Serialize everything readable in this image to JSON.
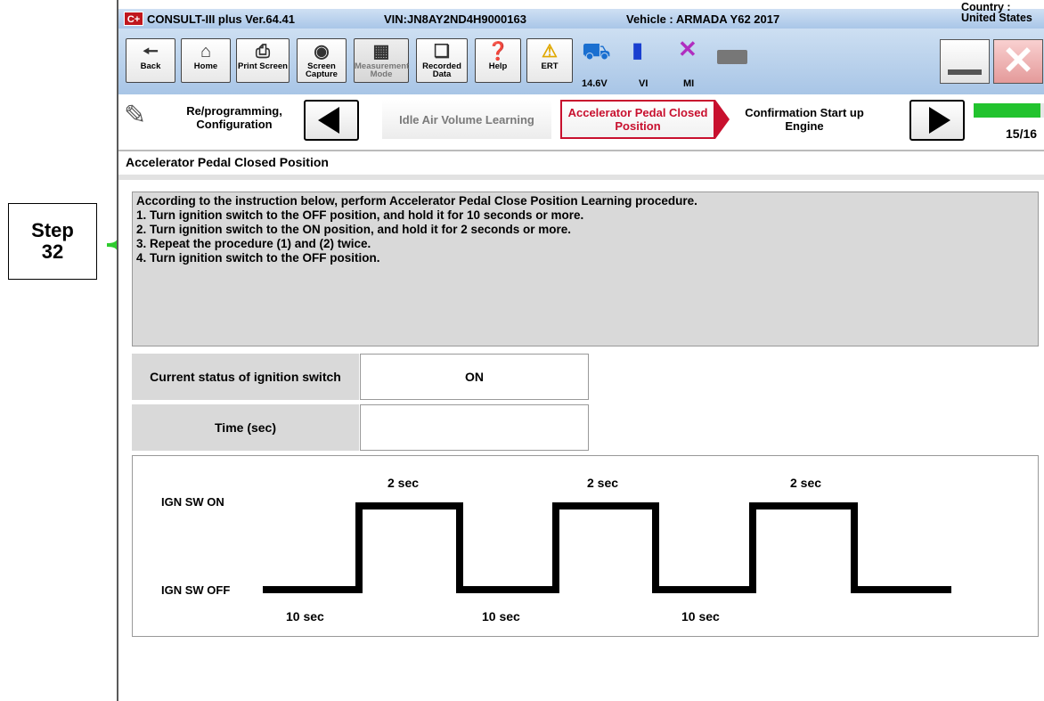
{
  "callout": {
    "line1": "Step",
    "line2": "32"
  },
  "titlebar": {
    "app_logo": "C+",
    "app_name": "CONSULT-III plus  Ver.64.41",
    "vin": "VIN:JN8AY2ND4H9000163",
    "vehicle": "Vehicle : ARMADA Y62 2017",
    "country": "Country : United States"
  },
  "toolbar": {
    "back": "Back",
    "home": "Home",
    "print": "Print Screen",
    "capture": "Screen Capture",
    "measurement": "Measurement Mode",
    "recorded": "Recorded Data",
    "help": "Help",
    "ert": "ERT",
    "voltage": "14.6V",
    "vi": "VI",
    "mi": "MI"
  },
  "nav": {
    "reprog": "Re/programming, Configuration",
    "idle": "Idle Air Volume Learning",
    "accel": "Accelerator Pedal Closed Position",
    "confirm": "Confirmation Start up Engine",
    "progress": "15/16",
    "progress_fraction": 0.9375
  },
  "page_title": "Accelerator Pedal Closed Position",
  "instructions": "According to the instruction below, perform Accelerator Pedal Close Position Learning procedure.\n1. Turn ignition switch to the OFF position, and hold it for 10 seconds or more.\n2. Turn ignition switch to the ON position, and hold it for 2 seconds or more.\n3. Repeat the procedure (1) and (2) twice.\n4. Turn ignition switch to the OFF position.",
  "status": {
    "ign_label": "Current status of ignition switch",
    "ign_value": "ON",
    "time_label": "Time (sec)",
    "time_value": ""
  },
  "diagram": {
    "on_label": "IGN SW ON",
    "off_label": "IGN SW OFF",
    "on_durations": [
      "2 sec",
      "2 sec",
      "2 sec"
    ],
    "off_durations": [
      "10 sec",
      "10 sec",
      "10 sec"
    ]
  },
  "colors": {
    "active_step": "#c8102e",
    "progress": "#22c32e",
    "brace": "#2ecc2e"
  }
}
